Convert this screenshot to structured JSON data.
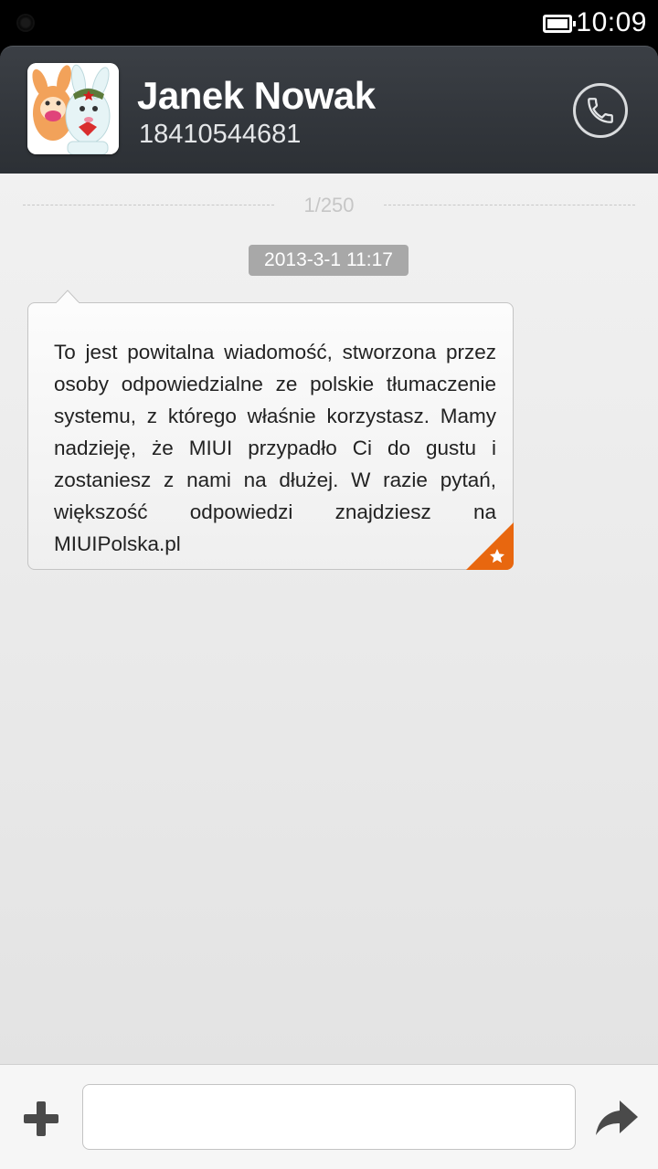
{
  "status_bar": {
    "time": "10:09",
    "battery_icon": "battery-full-icon"
  },
  "header": {
    "contact_name": "Janek Nowak",
    "contact_number": "18410544681",
    "avatar_icon": "mitu-bunny-avatar",
    "call_icon": "phone-icon"
  },
  "conversation": {
    "counter": "1/250",
    "messages": [
      {
        "timestamp": "2013-3-1 11:17",
        "text": "To jest powitalna wiadomość, stworzona przez osoby odpowiedzialne ze polskie tłumaczenie systemu, z którego właśnie korzystasz. Mamy nadzieję, że MIUI przypadło Ci do gustu i zostaniesz z nami na dłużej. W razie pytań, większość odpowiedzi znajdziesz na MIUIPolska.pl",
        "starred": true
      }
    ]
  },
  "composer": {
    "input_value": "",
    "input_placeholder": "",
    "add_icon": "plus-icon",
    "send_icon": "send-arrow-icon"
  },
  "colors": {
    "header_bg": "#33373c",
    "star_accent": "#e8670f",
    "timestamp_bg": "#a8a8a8"
  }
}
